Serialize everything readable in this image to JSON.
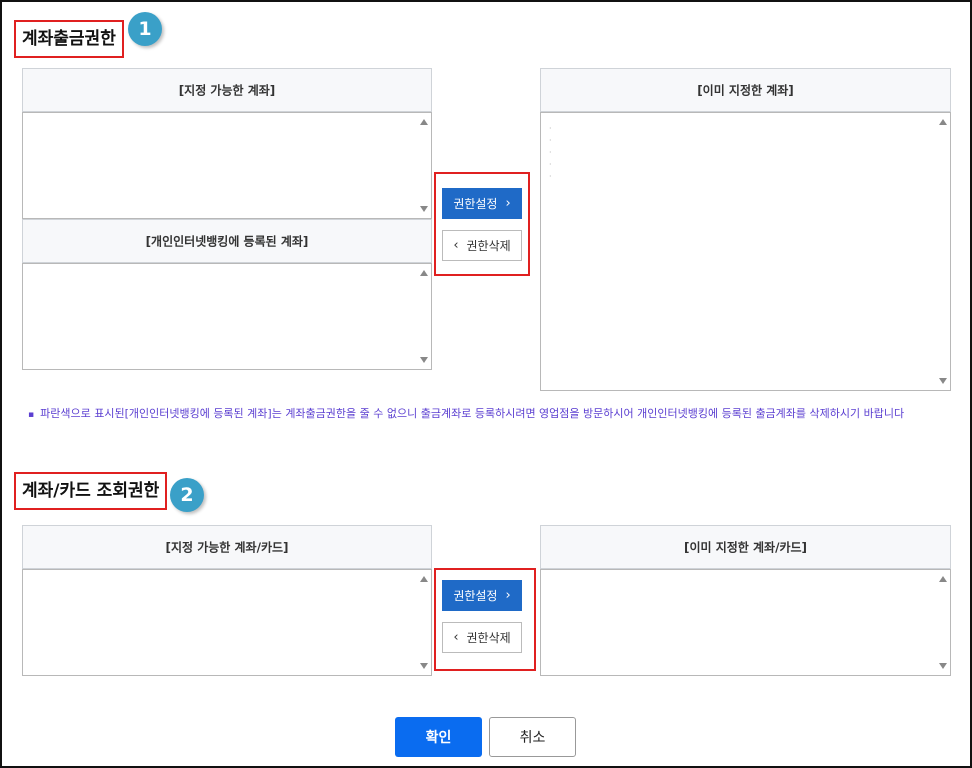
{
  "section1": {
    "title": "계좌출금권한",
    "badge": "1",
    "available_header": "[지정 가능한 계좌]",
    "registered_header": "[개인인터넷뱅킹에 등록된 계좌]",
    "assigned_header": "[이미 지정한 계좌]",
    "grant_label": "권한설정",
    "revoke_label": "권한삭제",
    "note": "파란색으로 표시된[개인인터넷뱅킹에 등록된 계좌]는 계좌출금권한을 줄 수 없으니 출금계좌로 등록하시려면 영업점을 방문하시어 개인인터넷뱅킹에 등록된 출금계좌를 삭제하시기 바랍니다"
  },
  "section2": {
    "title": "계좌/카드 조회권한",
    "badge": "2",
    "available_header": "[지정 가능한 계좌/카드]",
    "assigned_header": "[이미 지정한 계좌/카드]",
    "grant_label": "권한설정",
    "revoke_label": "권한삭제"
  },
  "footer": {
    "confirm_label": "확인",
    "cancel_label": "취소"
  },
  "icons": {
    "right": "chevron-right-icon",
    "left": "chevron-left-icon",
    "scroll_up": "scroll-up-icon",
    "scroll_down": "scroll-down-icon"
  },
  "colors": {
    "accent": "#1f6ac7",
    "confirm": "#0a6cf0",
    "highlight": "#e02020",
    "badge": "#3aa0c8",
    "note": "#5b3fd1"
  }
}
